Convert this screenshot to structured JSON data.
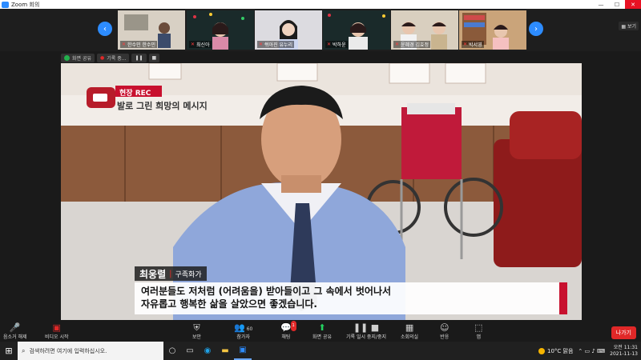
{
  "window": {
    "title": "Zoom 회의",
    "btn_min": "—",
    "btn_max": "☐",
    "btn_close": "✕"
  },
  "gallery": {
    "view_label": "▦ 보기",
    "participants": [
      {
        "name": "한수민 한수민"
      },
      {
        "name": "최신아"
      },
      {
        "name": "쒸아진 유누리"
      },
      {
        "name": "박하윤"
      },
      {
        "name": "윤혜경 김효정"
      },
      {
        "name": "박서영"
      }
    ]
  },
  "share": {
    "label": "화면 공유",
    "record_label": "기록 중..."
  },
  "broadcast": {
    "badge": "현장 REC",
    "headline": "발로 그린 희망의 메시지",
    "speaker_name": "최웅렬",
    "speaker_title": "구족화가",
    "subtitle_line1": "여러분들도 저처럼 (어려움을) 받아들이고 그 속에서 벗어나서",
    "subtitle_line2": "자유롭고 행복한 삶을 살았으면 좋겠습니다."
  },
  "controls": {
    "mute": "음소거 해제",
    "video": "비디오 시작",
    "security": "보안",
    "participants": "참가자",
    "participants_count": "60",
    "chat": "채팅",
    "chat_badge": "1",
    "share": "화면 공유",
    "record": "기록 일시 중지/중지",
    "breakout": "소회의실",
    "reactions": "반응",
    "apps": "앱",
    "leave": "나가기"
  },
  "taskbar": {
    "search_placeholder": "검색하려면 여기에 입력하십시오.",
    "weather": "10°C 맑음",
    "time": "오전 11:31",
    "date": "2021-11-13"
  }
}
